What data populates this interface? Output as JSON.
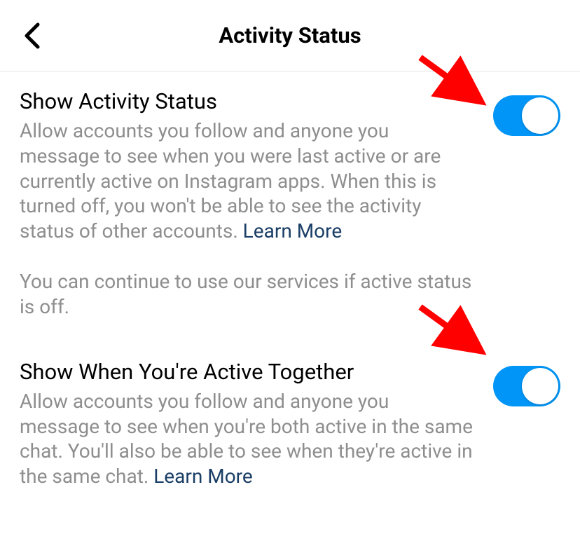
{
  "header": {
    "title": "Activity Status"
  },
  "settings": {
    "activity_status": {
      "title": "Show Activity Status",
      "description": "Allow accounts you follow and anyone you message to see when you were last active or are currently active on Instagram apps. When this is turned off, you won't be able to see the activity status of other accounts. ",
      "learn_more": "Learn More",
      "extra": "You can continue to use our services if active status is off.",
      "enabled": true
    },
    "active_together": {
      "title": "Show When You're Active Together",
      "description": "Allow accounts you follow and anyone you message to see when you're both active in the same chat. You'll also be able to see when they're active in the same chat. ",
      "learn_more": "Learn More",
      "enabled": true
    }
  },
  "colors": {
    "toggle_on": "#0095f6",
    "link": "#1a3e66",
    "secondary_text": "#8e8e8e",
    "annotation_arrow": "#ff0000"
  }
}
